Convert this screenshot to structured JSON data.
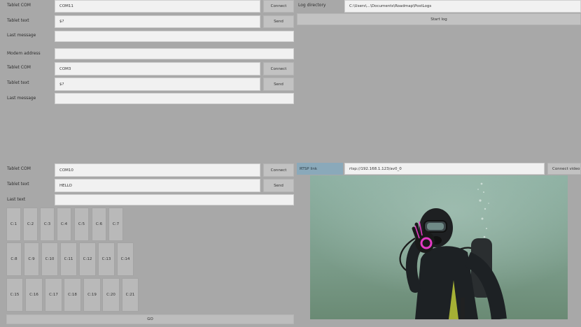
{
  "panel1": {
    "com_label": "Tablet COM",
    "com_value": "COM11",
    "connect_label": "Connect",
    "text_label": "Tablet text",
    "text_value": "$?",
    "send_label": "Send",
    "last_label": "Last message",
    "last_value": ""
  },
  "log": {
    "dir_label": "Log directory",
    "dir_value": "C:\\Users\\...\\Documents\\Roadmap\\PostLogs",
    "start_label": "Start log"
  },
  "panel2": {
    "modem_label": "Modem address",
    "modem_value": "",
    "com_label": "Tablet COM",
    "com_value": "COM3",
    "connect_label": "Connect",
    "text_label": "Tablet text",
    "text_value": "$?",
    "send_label": "Send",
    "last_label": "Last message",
    "last_value": ""
  },
  "panel3": {
    "com_label": "Tablet COM",
    "com_value": "COM10",
    "connect_label": "Connect",
    "text_label": "Tablet text",
    "text_value": "HELLO",
    "send_label": "Send",
    "last_label": "Last text",
    "last_value": "",
    "row1": [
      "C:1",
      "C:2",
      "C:3",
      "C:4",
      "C:5",
      "C:6",
      "C:7"
    ],
    "row2": [
      "C:8",
      "C:9",
      "C:10",
      "C:11",
      "C:12",
      "C:13",
      "C:14"
    ],
    "row3": [
      "C:15",
      "C:16",
      "C:17",
      "C:18",
      "C:19",
      "C:20",
      "C:21"
    ],
    "go_label": "GO"
  },
  "rtsp": {
    "label": "RTSP link",
    "value": "rtsp://192.168.1.123/av0_0",
    "connect_label": "Connect video"
  },
  "colors": {
    "background": "#a8a8a8",
    "field": "#f1f1f1",
    "button": "#c2c2c2",
    "rtsp_label": "#8aa9ba",
    "water": "#7fa08e"
  }
}
